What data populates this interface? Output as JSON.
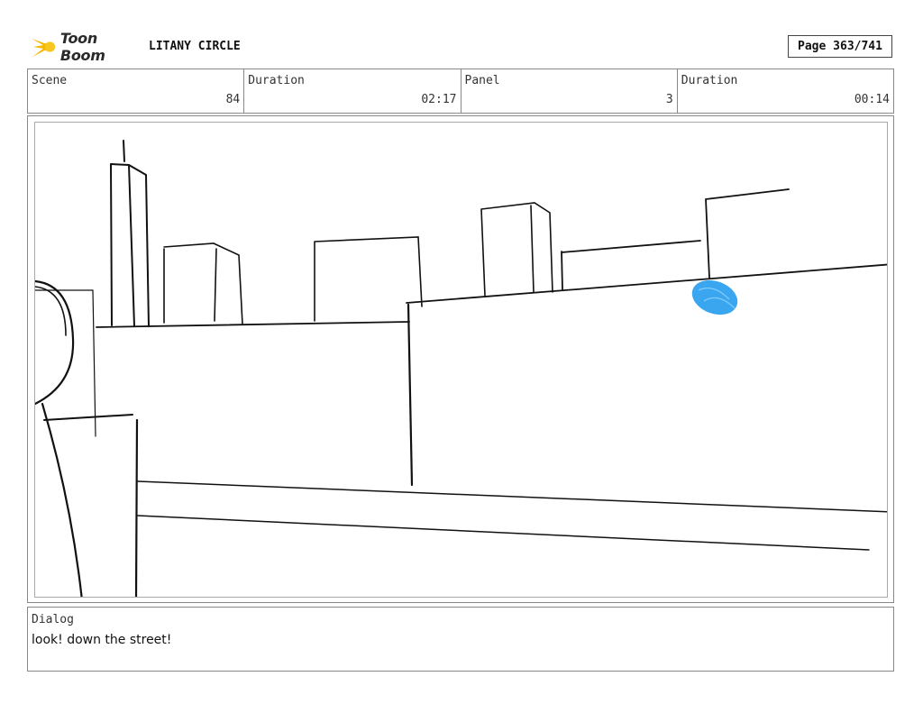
{
  "header": {
    "logo_text": "Toon Boom",
    "project_title": "LITANY CIRCLE",
    "page_label": "Page 363/741"
  },
  "info": {
    "scene_label": "Scene",
    "scene_value": "84",
    "scene_duration_label": "Duration",
    "scene_duration_value": "02:17",
    "panel_label": "Panel",
    "panel_value": "3",
    "panel_duration_label": "Duration",
    "panel_duration_value": "00:14"
  },
  "dialog": {
    "label": "Dialog",
    "text": "look! down the street!"
  },
  "colors": {
    "logo_star": "#f5b800",
    "sketch_line": "#111111",
    "blue_blob": "#3aa6ef"
  }
}
